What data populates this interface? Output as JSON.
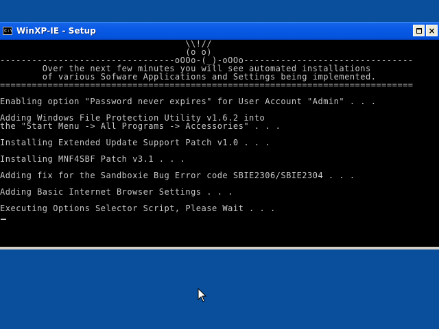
{
  "window": {
    "title": "WinXP-IE - Setup",
    "icon_label": "C:\\"
  },
  "console": {
    "lines": [
      "                                   \\\\!//",
      "                                   (o o)",
      "---------------------------------oOOo-(_)-oOOo--------------------------------",
      "        Over the next few minutes you will see automated installations",
      "        of various Sofware Applications and Settings being implemented.",
      "==============================================================================",
      "",
      "Enabling option \"Password never expires\" for User Account \"Admin\" . . .",
      "",
      "Adding Windows File Protection Utility v1.6.2 into",
      "the \"Start Menu -> All Programs -> Accessories\" . . .",
      "",
      "Installing Extended Update Support Patch v1.0 . . .",
      "",
      "Installing MNF4SBF Patch v3.1 . . .",
      "",
      "Adding fix for the Sandboxie Bug Error code SBIE2306/SBIE2304 . . .",
      "",
      "Adding Basic Internet Browser Settings . . .",
      "",
      "Executing Options Selector Script, Please Wait . . ."
    ]
  },
  "colors": {
    "desktop": "#0a4f9b",
    "console_bg": "#000000",
    "console_fg": "#c8c8c8",
    "titlebar": "#0a5ae6"
  }
}
